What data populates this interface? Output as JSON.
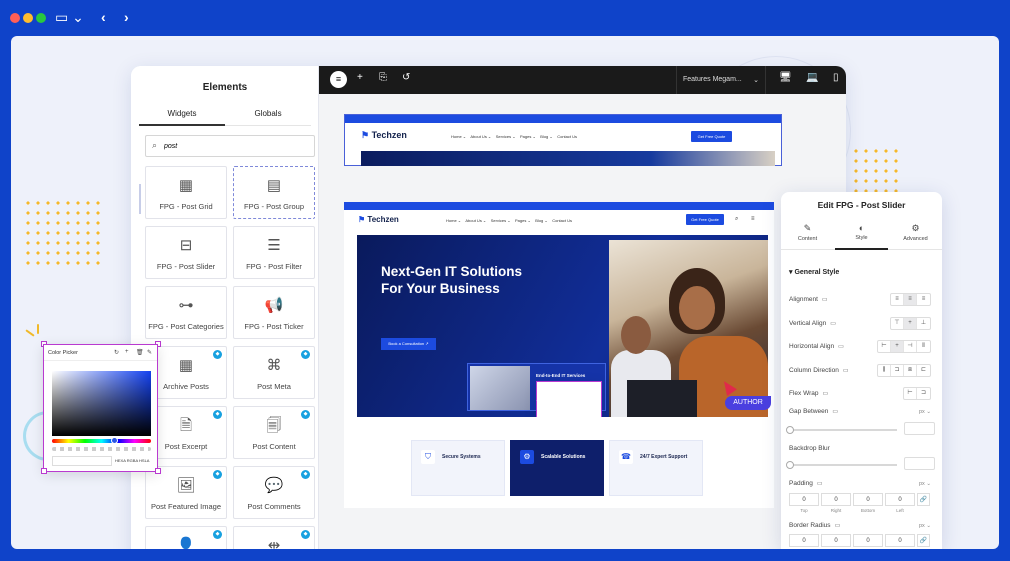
{
  "window": {
    "icons": [
      "sidebar-icon",
      "chevron-left-icon",
      "chevron-right-icon"
    ]
  },
  "panel": {
    "title": "Elements",
    "tabs": [
      "Widgets",
      "Globals"
    ],
    "search_value": "post",
    "widgets": [
      {
        "label": "FPG - Post Grid",
        "icon": "grid-icon"
      },
      {
        "label": "FPG - Post Group",
        "icon": "group-icon"
      },
      {
        "label": "FPG - Post Slider",
        "icon": "slider-icon"
      },
      {
        "label": "FPG - Post Filter",
        "icon": "filter-icon"
      },
      {
        "label": "FPG - Post Categories",
        "icon": "categories-icon"
      },
      {
        "label": "FPG - Post Ticker",
        "icon": "ticker-icon"
      },
      {
        "label": "Archive Posts",
        "icon": "archive-icon"
      },
      {
        "label": "Post Meta",
        "icon": "tag-icon"
      },
      {
        "label": "Post Excerpt",
        "icon": "excerpt-icon"
      },
      {
        "label": "Post Content",
        "icon": "content-icon"
      },
      {
        "label": "Post Featured Image",
        "icon": "image-icon"
      },
      {
        "label": "Post Comments",
        "icon": "comments-icon"
      },
      {
        "label": "",
        "icon": "author-icon"
      },
      {
        "label": "",
        "icon": "navigation-icon"
      }
    ]
  },
  "toolbar": {
    "template_name": "Features Megam..."
  },
  "site": {
    "brand": "Techzen",
    "nav": [
      "Home",
      "About Us",
      "Services",
      "Pages",
      "Blog",
      "Contact Us"
    ],
    "quote_btn": "Get Free Quote",
    "hero_title_1": "Next-Gen IT Solutions",
    "hero_title_2": "For Your Business",
    "hero_button": "Book a Consultation",
    "card_title": "End-to-End IT Services",
    "author_badge": "AUTHOR",
    "features": [
      {
        "title": "Secure Systems"
      },
      {
        "title": "Scalable Solutions"
      },
      {
        "title": "24/7 Expert Support"
      }
    ]
  },
  "edit": {
    "title": "Edit FPG - Post Slider",
    "tabs": [
      "Content",
      "Style",
      "Advanced"
    ],
    "section": "General Style",
    "rows": {
      "alignment": "Alignment",
      "vertical": "Vertical Align",
      "horizontal": "Horizontal Align",
      "direction": "Column Direction",
      "wrap": "Flex Wrap",
      "gap": "Gap Between",
      "blur": "Backdrop Blur",
      "padding": "Padding",
      "radius": "Border Radius"
    },
    "unit": "px",
    "dim_labels": [
      "Top",
      "Right",
      "Bottom",
      "Left"
    ],
    "dim_value": "0"
  },
  "color_picker": {
    "title": "Color Picker",
    "modes": "HEXA RGBA HSLA"
  },
  "colors": {
    "frame": "#0f43c9",
    "accent": "#1c4be0",
    "picker_border": "#b93ad0",
    "author": "#4a3fe0"
  }
}
